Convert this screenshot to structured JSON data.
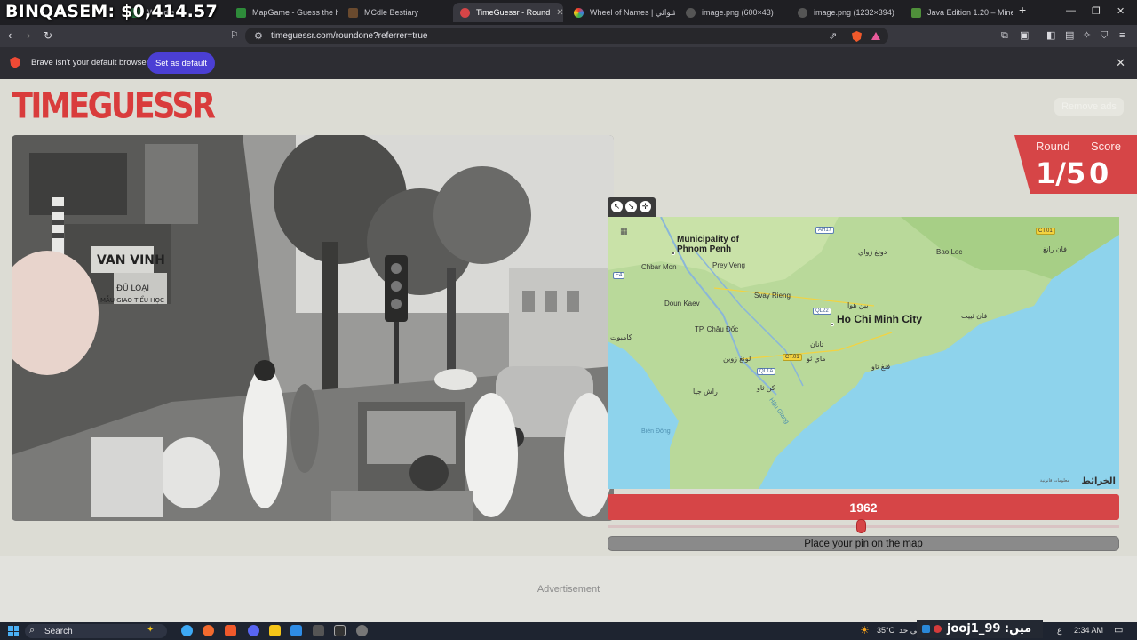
{
  "overlay_text": "BINQASEM: $0,414.57",
  "tabs": [
    {
      "label": "Worldle",
      "fav_color": "#2d7d46",
      "active": false
    },
    {
      "label": "MapGame - Guess the hid",
      "fav_color": "#2e8b3a",
      "active": false
    },
    {
      "label": "MCdle Bestiary",
      "fav_color": "#6a4a2e",
      "active": false
    },
    {
      "label": "TimeGuessr - Round",
      "fav_color": "#d64547",
      "active": true
    },
    {
      "label": "Wheel of Names | عشوائي",
      "fav_color": "#3d7fe0",
      "active": false
    },
    {
      "label": "image.png (600×43)",
      "fav_color": "#666",
      "active": false
    },
    {
      "label": "image.png (1232×394)",
      "fav_color": "#666",
      "active": false
    },
    {
      "label": "Java Edition 1.20 – Minec",
      "fav_color": "#4f8f3a",
      "active": false
    }
  ],
  "url": "timeguessr.com/roundone?referrer=true",
  "infobar": {
    "message": "Brave isn't your default browser",
    "button": "Set as default"
  },
  "logo": "TIMEGUESSR",
  "remove_ads": "Remove ads",
  "score": {
    "round_label": "Round",
    "round_value": "1/5",
    "score_label": "Score",
    "score_value": "0"
  },
  "photo_signs": [
    "VAN VINH",
    "ĐỦ LOẠI",
    "MẪU GIAO TIỂU HỌC"
  ],
  "map": {
    "labels": [
      {
        "text": "Municipality of Phnom Penh",
        "cls": "med"
      },
      {
        "text": "Chbar Mon",
        "cls": ""
      },
      {
        "text": "Prey Veng",
        "cls": ""
      },
      {
        "text": "Svay Rieng",
        "cls": ""
      },
      {
        "text": "Doun Kaev",
        "cls": ""
      },
      {
        "text": "TP. Châu Đốc",
        "cls": ""
      },
      {
        "text": "كامبوت",
        "cls": ""
      },
      {
        "text": "Ho Chi Minh City",
        "cls": "big"
      },
      {
        "text": "بين هوا",
        "cls": ""
      },
      {
        "text": "دونغ زواي",
        "cls": ""
      },
      {
        "text": "Bao Loc",
        "cls": ""
      },
      {
        "text": "فان رانغ",
        "cls": ""
      },
      {
        "text": "فان ثييت",
        "cls": ""
      },
      {
        "text": "تانان",
        "cls": ""
      },
      {
        "text": "ماي ثو",
        "cls": ""
      },
      {
        "text": "فنغ تاو",
        "cls": ""
      },
      {
        "text": "لونغ زوين",
        "cls": ""
      },
      {
        "text": "كن ثاو",
        "cls": ""
      },
      {
        "text": "راش جيا",
        "cls": ""
      }
    ],
    "shields": [
      "AH17",
      "CT.01",
      "QL22",
      "CT.01",
      "QL1A",
      "E4"
    ],
    "water_labels": [
      "Biển Đông",
      "Hậu Giang"
    ],
    "brand": "الخرائط",
    "legal": "معلومات قانونية"
  },
  "year": "1962",
  "pin_button": "Place your pin on the map",
  "advertisement": "Advertisement",
  "taskbar": {
    "search": "Search",
    "temperature": "35°C",
    "weather_text": "مشمس إلى حد",
    "streamer": "jooj1_99 :مين هوا",
    "lang": "ع",
    "time": "2:34 AM"
  },
  "colors": {
    "accent_red": "#d64547",
    "brave_purple": "#4b3fd4"
  }
}
